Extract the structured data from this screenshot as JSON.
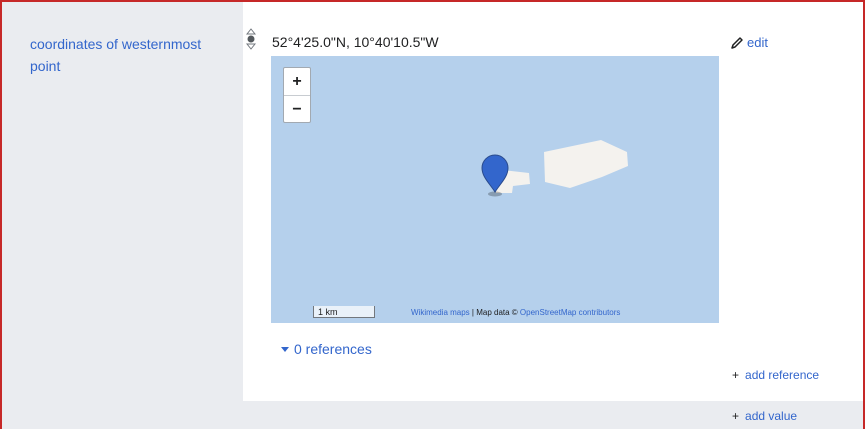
{
  "property": {
    "label": "coordinates of westernmost point"
  },
  "statement": {
    "coordinates": "52°4'25.0\"N, 10°40'10.5\"W",
    "edit_label": "edit"
  },
  "map": {
    "zoom_in_label": "+",
    "zoom_out_label": "−",
    "scale_label": "1 km",
    "attribution_source": "Wikimedia maps",
    "attribution_middle": " | Map data © ",
    "attribution_osm": "OpenStreetMap contributors",
    "water_color": "#b5d0ec",
    "land_color": "#f2efe9",
    "marker_color": "#3366cc"
  },
  "references": {
    "label": "0 references"
  },
  "actions": {
    "add_reference": "add reference",
    "add_value": "add value",
    "plus_symbol": "+"
  },
  "colors": {
    "link": "#3366cc",
    "frame": "#c62828",
    "sidebar": "#eaecf0"
  }
}
